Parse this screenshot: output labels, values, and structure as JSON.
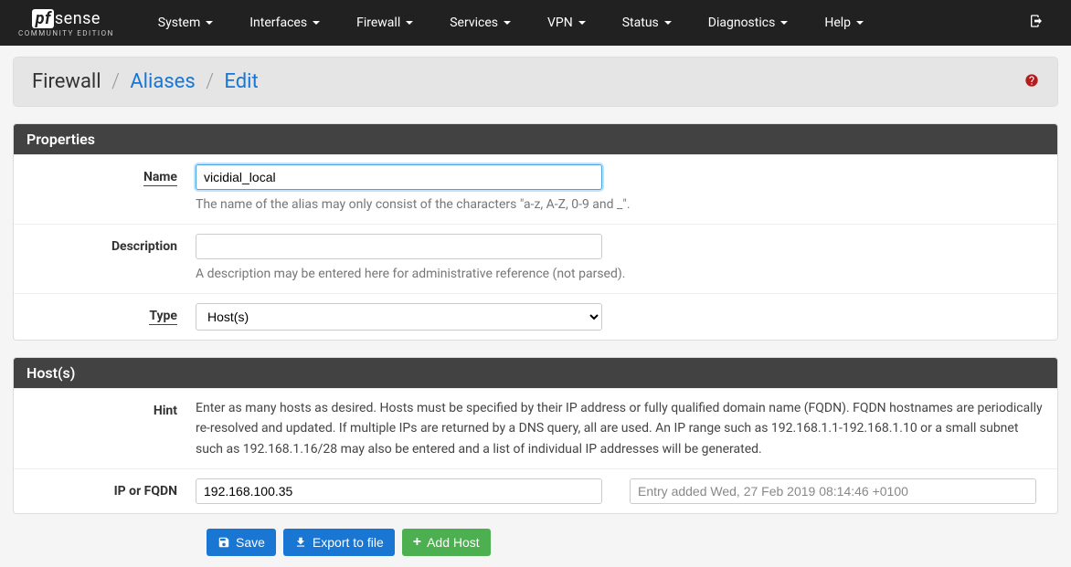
{
  "logo": {
    "pf": "pf",
    "sense": "sense",
    "sub": "COMMUNITY EDITION"
  },
  "nav": [
    "System",
    "Interfaces",
    "Firewall",
    "Services",
    "VPN",
    "Status",
    "Diagnostics",
    "Help"
  ],
  "breadcrumb": {
    "root": "Firewall",
    "mid": "Aliases",
    "leaf": "Edit"
  },
  "panels": {
    "properties": {
      "title": "Properties",
      "name": {
        "label": "Name",
        "value": "vicidial_local",
        "help": "The name of the alias may only consist of the characters \"a-z, A-Z, 0-9 and _\"."
      },
      "description": {
        "label": "Description",
        "value": "",
        "help": "A description may be entered here for administrative reference (not parsed)."
      },
      "type": {
        "label": "Type",
        "value": "Host(s)"
      }
    },
    "hosts": {
      "title": "Host(s)",
      "hint_label": "Hint",
      "hint": "Enter as many hosts as desired. Hosts must be specified by their IP address or fully qualified domain name (FQDN). FQDN hostnames are periodically re-resolved and updated. If multiple IPs are returned by a DNS query, all are used. An IP range such as 192.168.1.1-192.168.1.10 or a small subnet such as 192.168.1.16/28 may also be entered and a list of individual IP addresses will be generated.",
      "row_label": "IP or FQDN",
      "ip": "192.168.100.35",
      "entry_desc": "Entry added Wed, 27 Feb 2019 08:14:46 +0100"
    }
  },
  "buttons": {
    "save": "Save",
    "export": "Export to file",
    "add": "Add Host"
  }
}
